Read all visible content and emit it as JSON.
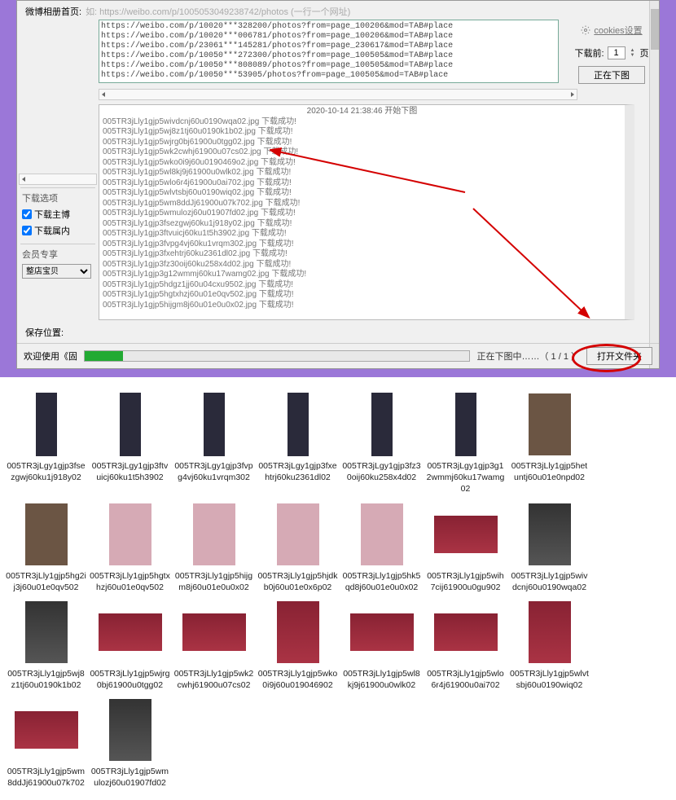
{
  "url_row": {
    "label": "微博相册首页:",
    "hint": "如: https://weibo.com/p/1005053049238742/photos  (一行一个网址)"
  },
  "url_list": "https://weibo.com/p/10020***328200/photos?from=page_100206&mod=TAB#place\nhttps://weibo.com/p/10020***006781/photos?from=page_100206&mod=TAB#place\nhttps://weibo.com/p/23061***145281/photos?from=page_230617&mod=TAB#place\nhttps://weibo.com/p/10050***272300/photos?from=page_100505&mod=TAB#place\nhttps://weibo.com/p/10050***808089/photos?from=page_100505&mod=TAB#place\nhttps://weibo.com/p/10050***53905/photos?from=page_100505&mod=TAB#place",
  "right_panel": {
    "cookies_label": "cookies设置",
    "before_label": "下载前:",
    "page_value": "1",
    "page_unit": "页",
    "dl_button": "正在下图"
  },
  "log": {
    "header": " 2020-10-14 21:38:46 开始下图 ",
    "lines": [
      "005TR3jLly1gjp5wivdcnj60u0190wqa02.jpg 下载成功!",
      "005TR3jLly1gjp5wj8z1tj60u0190k1b02.jpg 下载成功!",
      "005TR3jLly1gjp5wjrg0bj61900u0tgg02.jpg 下载成功!",
      "005TR3jLly1gjp5wk2cwhj61900u07cs02.jpg 下载成功!",
      "005TR3jLly1gjp5wko0i9j60u0190469o2.jpg 下载成功!",
      "005TR3jLly1gjp5wl8kj9j61900u0wlk02.jpg 下载成功!",
      "005TR3jLly1gjp5wlo6r4j61900u0ai702.jpg 下载成功!",
      "005TR3jLly1gjp5wlvtsbj60u0190wiq02.jpg 下载成功!",
      "005TR3jLly1gjp5wm8ddJj61900u07k702.jpg 下载成功!",
      "005TR3jLly1gjp5wmulozj60u01907fd02.jpg 下载成功!",
      "005TR3jLly1gjp3fsezgwj60ku1j918y02.jpg 下载成功!",
      "005TR3jLly1gjp3ftvuicj60ku1t5h3902.jpg 下载成功!",
      "005TR3jLly1gjp3fvpg4vj60ku1vrqm302.jpg 下载成功!",
      "005TR3jLly1gjp3fxehtrj60ku2361dl02.jpg 下载成功!",
      "005TR3jLly1gjp3fz30oij60ku258x4d02.jpg 下载成功!",
      "005TR3jLly1gjp3g12wmmj60ku17wamg02.jpg 下载成功!",
      "005TR3jLly1gjp5hdgz1jj60u04cxu9502.jpg 下载成功!",
      "005TR3jLly1gjp5hgtxhzj60u01e0qv502.jpg 下载成功!",
      "005TR3jLly1gjp5hijgm8j60u01e0u0x02.jpg 下载成功!"
    ]
  },
  "left_options": {
    "title1": "下载选项",
    "chk1": "下载主博",
    "chk2": "下载属内",
    "title2": "会员专享",
    "combo": "整店宝贝",
    "save_label": "保存位置:"
  },
  "bottom_bar": {
    "welcome": "欢迎使用《固",
    "status": "正在下图中……（ 1 / 1 ）",
    "open_folder": "打开文件夹"
  },
  "files": [
    {
      "name": "005TR3jLgy1gjp3fsezgwj60ku1j918y02",
      "shape": "tall"
    },
    {
      "name": "005TR3jLgy1gjp3ftvuicj60ku1t5h3902",
      "shape": "tall"
    },
    {
      "name": "005TR3jLgy1gjp3fvpg4vj60ku1vrqm302",
      "shape": "tall"
    },
    {
      "name": "005TR3jLgy1gjp3fxehtrj60ku2361dl02",
      "shape": "tall"
    },
    {
      "name": "005TR3jLgy1gjp3fz30oij60ku258x4d02",
      "shape": "tall"
    },
    {
      "name": "005TR3jLgy1gjp3g12wmmj60ku17wamg02",
      "shape": "tall"
    },
    {
      "name": "005TR3jLly1gjp5hetuntj60u01e0npd02",
      "shape": "port",
      "cls": "brown"
    },
    {
      "name": "005TR3jLly1gjp5hg2ij3j60u01e0qv502",
      "shape": "port",
      "cls": "brown"
    },
    {
      "name": "005TR3jLly1gjp5hgtxhzj60u01e0qv502",
      "shape": "port",
      "cls": "pink"
    },
    {
      "name": "005TR3jLly1gjp5hijgm8j60u01e0u0x02",
      "shape": "port",
      "cls": "pink"
    },
    {
      "name": "005TR3jLly1gjp5hjdkb0j60u01e0x6p02",
      "shape": "port",
      "cls": "pink"
    },
    {
      "name": "005TR3jLly1gjp5hk5qd8j60u01e0u0x02",
      "shape": "port",
      "cls": "pink"
    },
    {
      "name": "005TR3jLly1gjp5wih7cij61900u0gu902",
      "shape": "land",
      "cls": "red"
    },
    {
      "name": "005TR3jLly1gjp5wivdcnj60u0190wqa02",
      "shape": "port",
      "cls": "dark"
    },
    {
      "name": "005TR3jLly1gjp5wj8z1tj60u0190k1b02",
      "shape": "port",
      "cls": "dark"
    },
    {
      "name": "005TR3jLly1gjp5wjrg0bj61900u0tgg02",
      "shape": "land",
      "cls": "red"
    },
    {
      "name": "005TR3jLly1gjp5wk2cwhj61900u07cs02",
      "shape": "land",
      "cls": "red"
    },
    {
      "name": "005TR3jLly1gjp5wko0i9j60u019046902",
      "shape": "port",
      "cls": "red"
    },
    {
      "name": "005TR3jLly1gjp5wl8kj9j61900u0wlk02",
      "shape": "land",
      "cls": "red"
    },
    {
      "name": "005TR3jLly1gjp5wlo6r4j61900u0ai702",
      "shape": "land",
      "cls": "red"
    },
    {
      "name": "005TR3jLly1gjp5wlvtsbj60u0190wiq02",
      "shape": "port",
      "cls": "red"
    },
    {
      "name": "005TR3jLly1gjp5wm8ddJj61900u07k702",
      "shape": "land",
      "cls": "red"
    },
    {
      "name": "005TR3jLly1gjp5wmulozj60u01907fd02",
      "shape": "port",
      "cls": "dark"
    }
  ]
}
